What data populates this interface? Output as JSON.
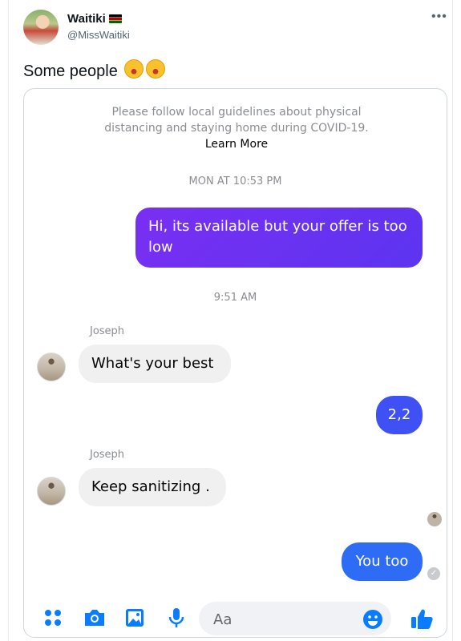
{
  "tweet": {
    "name": "Waitiki",
    "handle": "@MissWaitiki",
    "text": "Some people",
    "emoji": "rolling-on-floor-laughing-emoji"
  },
  "chat": {
    "notice_text": "Please follow local guidelines about physical distancing and staying home during COVID-19.",
    "notice_link": "Learn More",
    "timestamp_1": "MON AT 10:53 PM",
    "msg_1": "Hi, its available but your offer is too low",
    "timestamp_2": "9:51 AM",
    "sender_1": "Joseph",
    "msg_2": "What's your best",
    "msg_3": "2,2",
    "sender_2": "Joseph",
    "msg_4": "Keep sanitizing .",
    "msg_5": "You too",
    "composer_placeholder": "Aa"
  },
  "colors": {
    "accent_purple": "#7a2ff2",
    "accent_blue": "#2f6cf5",
    "icon_blue": "#0a7cff"
  }
}
